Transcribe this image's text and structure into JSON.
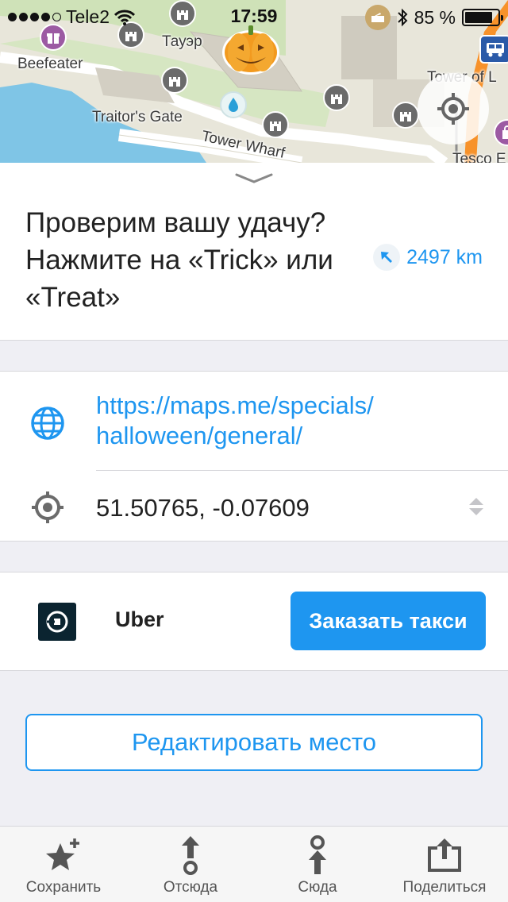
{
  "status_bar": {
    "carrier": "Tele2",
    "time": "17:59",
    "battery": "85 %",
    "battery_level": 0.85
  },
  "map": {
    "labels": {
      "beefeater": "Beefeater",
      "tower": "Тауэр",
      "traitors_gate": "Traitor's Gate",
      "tower_wharf": "Tower Wharf",
      "tower_of_london": "Tower of L",
      "tesco": "Tesco E"
    },
    "icons": [
      "gift-icon",
      "castle-icon",
      "pumpkin-icon",
      "water-drop-icon",
      "bus-icon",
      "shopping-bag-icon",
      "locate-me-icon"
    ]
  },
  "place": {
    "title": "Проверим вашу удачу? Нажмите на «Trick» или «Treat»",
    "distance": "2497 km",
    "website_line1": "https://maps.me/specials/",
    "website_line2": "halloween/general/",
    "coordinates": "51.50765, -0.07609"
  },
  "taxi": {
    "provider": "Uber",
    "button_label": "Заказать такси"
  },
  "edit_button_label": "Редактировать место",
  "bottom_bar": {
    "items": [
      {
        "label": "Сохранить",
        "icon": "star-plus-icon"
      },
      {
        "label": "Отсюда",
        "icon": "route-from-icon"
      },
      {
        "label": "Сюда",
        "icon": "route-to-icon"
      },
      {
        "label": "Поделиться",
        "icon": "share-icon"
      }
    ]
  },
  "colors": {
    "accent": "#1e96f0",
    "uber_bg": "#0b2430",
    "separator_bg": "#efeff4"
  }
}
